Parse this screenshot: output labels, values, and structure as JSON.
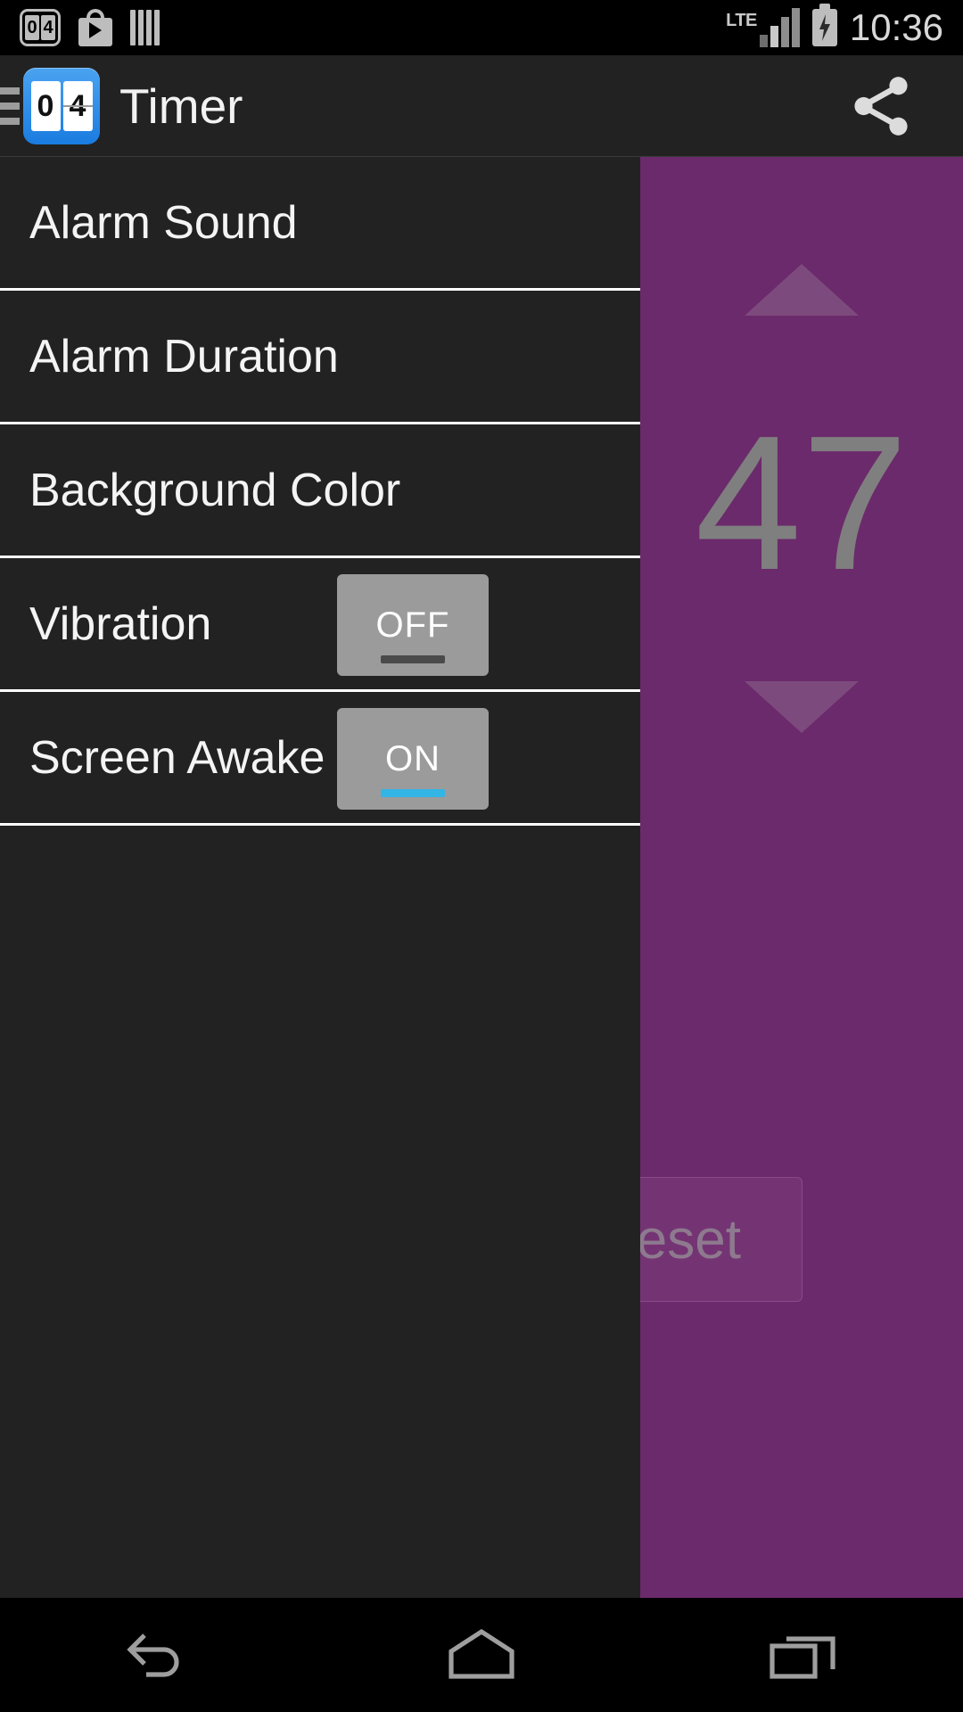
{
  "status_bar": {
    "icons": [
      "timer-app-icon",
      "play-store-icon",
      "bars-icon"
    ],
    "timer_icon_digits": [
      "0",
      "4"
    ],
    "network_label": "LTE",
    "signal_bars": 4,
    "battery_state": "charging",
    "time": "10:36"
  },
  "action_bar": {
    "menu_icon": "hamburger-icon",
    "app_icon_digits": [
      "0",
      "4"
    ],
    "title": "Timer",
    "share_icon": "share-icon"
  },
  "drawer": {
    "items": [
      {
        "label": "Alarm Sound",
        "toggle": null
      },
      {
        "label": "Alarm Duration",
        "toggle": null
      },
      {
        "label": "Background Color",
        "toggle": null
      },
      {
        "label": "Vibration",
        "toggle": "OFF"
      },
      {
        "label": "Screen Awake",
        "toggle": "ON"
      }
    ]
  },
  "timer_panel": {
    "increment_icon": "triangle-up-icon",
    "value": "47",
    "decrement_icon": "triangle-down-icon",
    "reset_label": "Reset",
    "background_color": "#6b2a6b",
    "value_color": "#7f7f7f"
  },
  "nav_bar": {
    "back_icon": "back-arrow-icon",
    "home_icon": "home-icon",
    "recents_icon": "recents-icon"
  },
  "colors": {
    "accent": "#33b5e5",
    "drawer_bg": "#222222",
    "panel_purple": "#6b2a6b",
    "toggle_bg": "#9b9b9b"
  }
}
